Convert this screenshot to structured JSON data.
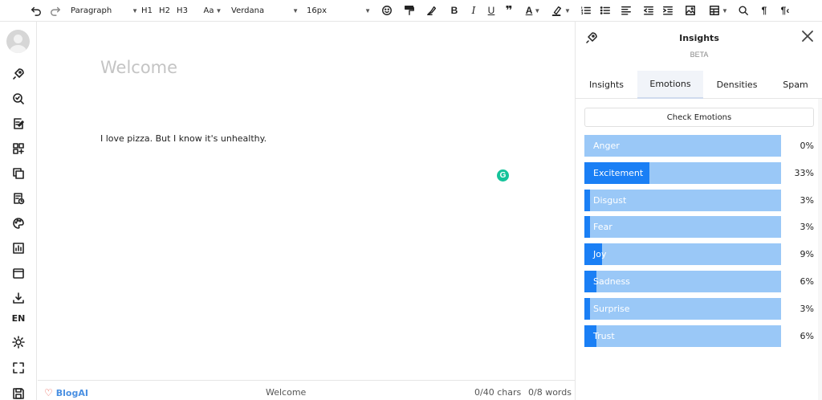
{
  "toolbar": {
    "block_format": "Paragraph",
    "h1": "H1",
    "h2": "H2",
    "h3": "H3",
    "font_size_label": "Aa",
    "font_family": "Verdana",
    "font_size": "16px"
  },
  "sidebar": {
    "language": "EN"
  },
  "editor": {
    "title_placeholder": "Welcome",
    "body_text": "I love pizza. But I know it's unhealthy."
  },
  "footer": {
    "brand": "BlogAI",
    "doc_title": "Welcome",
    "chars": "0/40 chars",
    "words": "0/8 words"
  },
  "panel": {
    "title": "Insights",
    "badge": "BETA",
    "tabs": [
      {
        "label": "Insights",
        "active": false
      },
      {
        "label": "Emotions",
        "active": true
      },
      {
        "label": "Densities",
        "active": false
      },
      {
        "label": "Spam",
        "active": false
      }
    ],
    "check_button": "Check Emotions",
    "emotions": [
      {
        "label": "Anger",
        "percent": "0%",
        "value": 0
      },
      {
        "label": "Excitement",
        "percent": "33%",
        "value": 33
      },
      {
        "label": "Disgust",
        "percent": "3%",
        "value": 3
      },
      {
        "label": "Fear",
        "percent": "3%",
        "value": 3
      },
      {
        "label": "Joy",
        "percent": "9%",
        "value": 9
      },
      {
        "label": "Sadness",
        "percent": "6%",
        "value": 6
      },
      {
        "label": "Surprise",
        "percent": "3%",
        "value": 3
      },
      {
        "label": "Trust",
        "percent": "6%",
        "value": 6
      }
    ]
  },
  "colors": {
    "bar_background": "#9ac8f7",
    "bar_fill": "#1a7ff5",
    "brand": "#4a90e2",
    "grammarly": "#15c39a"
  }
}
